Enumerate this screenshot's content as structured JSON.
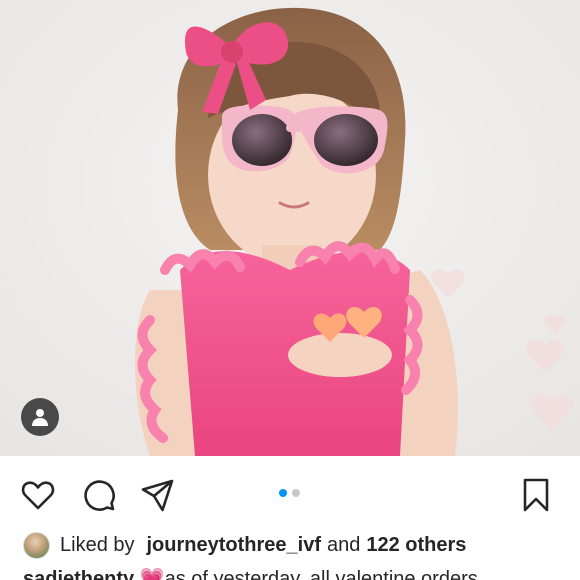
{
  "post": {
    "image_alt": "Toddler in pink sunglasses and pink ruffled swimsuit",
    "tag_icon": "person-icon",
    "carousel": {
      "count": 2,
      "active": 1
    }
  },
  "actions": {
    "like_icon": "heart-icon",
    "comment_icon": "comment-icon",
    "share_icon": "send-icon",
    "save_icon": "bookmark-icon"
  },
  "likes": {
    "prefix": "Liked by",
    "user": "journeytothree_ivf",
    "connector": "and",
    "others": "122 others"
  },
  "caption": {
    "username": "sadiethenty",
    "emoji": "💗",
    "text": "as of yesterday, all valentine orders"
  },
  "colors": {
    "accent": "#0095f6",
    "text": "#262626",
    "swimsuit": "#f0508a",
    "bow": "#ec4f86"
  }
}
